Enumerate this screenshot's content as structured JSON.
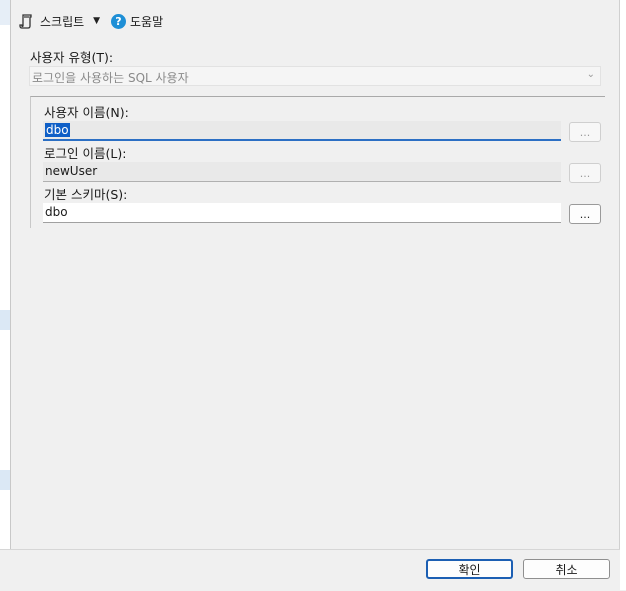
{
  "toolbar": {
    "script_label": "스크립트",
    "help_label": "도움말"
  },
  "user_type": {
    "label": "사용자 유형(T):",
    "value": "로그인을 사용하는 SQL 사용자"
  },
  "user_name": {
    "label": "사용자 이름(N):",
    "value": "dbo",
    "browse": "..."
  },
  "login_name": {
    "label": "로그인 이름(L):",
    "value": "newUser",
    "browse": "..."
  },
  "default_schema": {
    "label": "기본 스키마(S):",
    "value": "dbo",
    "browse": "..."
  },
  "footer": {
    "ok_label": "확인",
    "cancel_label": "취소"
  },
  "colors": {
    "accent": "#1c5fb3",
    "selection": "#0f5fc7",
    "help_icon": "#1e8fd6"
  }
}
